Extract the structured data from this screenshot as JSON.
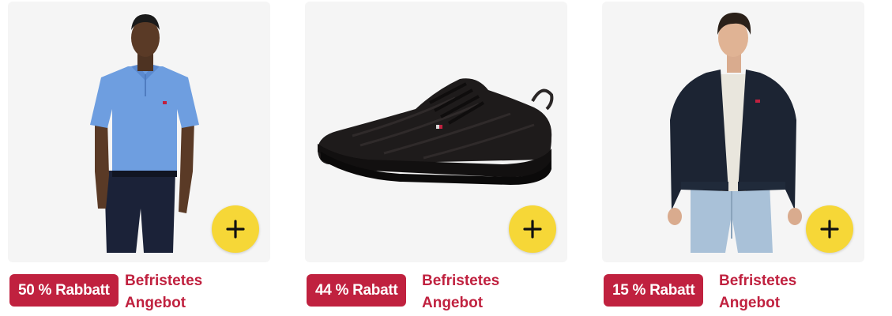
{
  "products": [
    {
      "id": "polo",
      "discount_label": "50 % Rabbatt",
      "offer_label": "Befristetes Angebot",
      "image": "man-in-blue-polo-shirt",
      "add_icon": "plus-icon"
    },
    {
      "id": "sneaker",
      "discount_label": "44 % Rabatt",
      "offer_label": "Befristetes Angebot",
      "image": "black-knit-sneaker",
      "add_icon": "plus-icon"
    },
    {
      "id": "jacket",
      "discount_label": "15 % Rabatt",
      "offer_label": "Befristetes Angebot",
      "image": "man-in-navy-jacket",
      "add_icon": "plus-icon"
    }
  ],
  "colors": {
    "badge": "#c0213f",
    "offer_text": "#c0213f",
    "add_button": "#f6d737",
    "tile_background": "#f5f5f5"
  }
}
